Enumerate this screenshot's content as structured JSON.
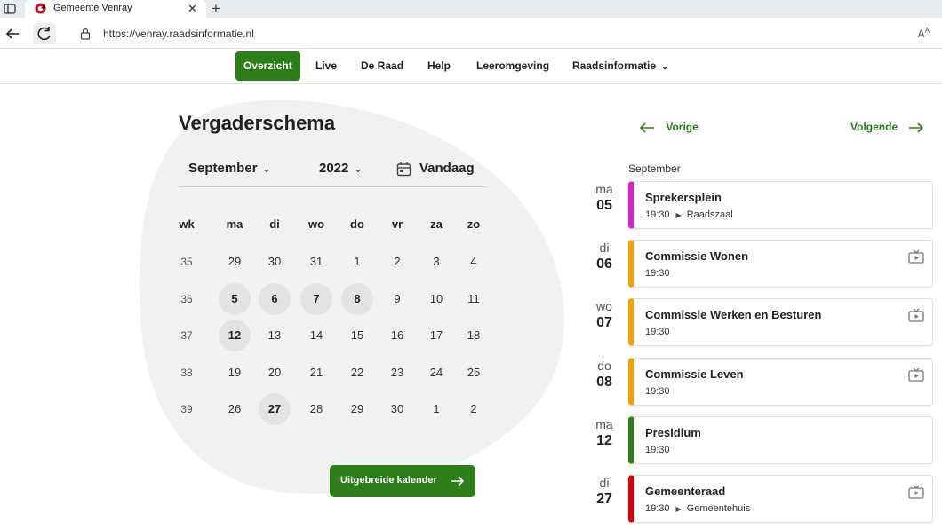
{
  "browser": {
    "tab_title": "Gemeente Venray",
    "url": "https://venray.raadsinformatie.nl",
    "read_aloud": "Aͅ"
  },
  "nav": {
    "items": [
      {
        "label": "Overzicht",
        "active": true
      },
      {
        "label": "Live"
      },
      {
        "label": "De Raad"
      },
      {
        "label": "Help"
      },
      {
        "label": "Leeromgeving"
      },
      {
        "label": "Raadsinformatie"
      }
    ]
  },
  "calendar": {
    "title": "Vergaderschema",
    "month": "September",
    "year": "2022",
    "today_label": "Vandaag",
    "headers": [
      "wk",
      "ma",
      "di",
      "wo",
      "do",
      "vr",
      "za",
      "zo"
    ],
    "weeks": [
      {
        "wk": "35",
        "days": [
          "29",
          "30",
          "31",
          "1",
          "2",
          "3",
          "4"
        ]
      },
      {
        "wk": "36",
        "days": [
          "5",
          "6",
          "7",
          "8",
          "9",
          "10",
          "11"
        ]
      },
      {
        "wk": "37",
        "days": [
          "12",
          "13",
          "14",
          "15",
          "16",
          "17",
          "18"
        ]
      },
      {
        "wk": "38",
        "days": [
          "19",
          "20",
          "21",
          "22",
          "23",
          "24",
          "25"
        ]
      },
      {
        "wk": "39",
        "days": [
          "26",
          "27",
          "28",
          "29",
          "30",
          "1",
          "2"
        ]
      }
    ],
    "meeting_days": [
      "5",
      "6",
      "7",
      "8",
      "12",
      "27"
    ],
    "extended_label": "Uitgebreide kalender"
  },
  "list": {
    "prev_label": "Vorige",
    "next_label": "Volgende",
    "month": "September",
    "meetings": [
      {
        "dow": "ma",
        "day": "05",
        "title": "Sprekersplein",
        "time": "19:30",
        "location": "Raadszaal",
        "color": "#e020c8",
        "has_video": false
      },
      {
        "dow": "di",
        "day": "06",
        "title": "Commissie Wonen",
        "time": "19:30",
        "location": "",
        "color": "#f5a000",
        "has_video": true
      },
      {
        "dow": "wo",
        "day": "07",
        "title": "Commissie Werken en Besturen",
        "time": "19:30",
        "location": "",
        "color": "#f5a000",
        "has_video": true
      },
      {
        "dow": "do",
        "day": "08",
        "title": "Commissie Leven",
        "time": "19:30",
        "location": "",
        "color": "#f5a000",
        "has_video": true
      },
      {
        "dow": "ma",
        "day": "12",
        "title": "Presidium",
        "time": "19:30",
        "location": "",
        "color": "#2d7d1a",
        "has_video": false
      },
      {
        "dow": "di",
        "day": "27",
        "title": "Gemeenteraad",
        "time": "19:30",
        "location": "Gemeentehuis",
        "color": "#e00000",
        "has_video": true
      }
    ]
  },
  "colors": {
    "accent": "#2d7d1a"
  }
}
